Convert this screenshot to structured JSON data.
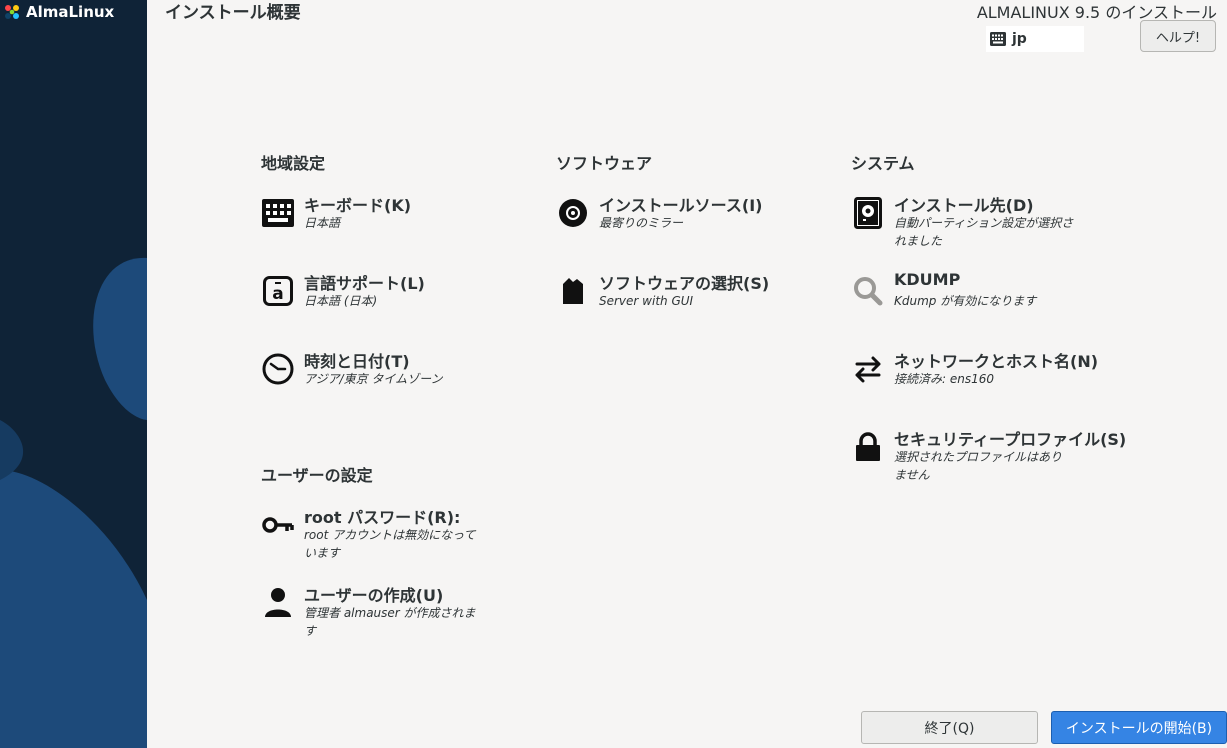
{
  "brand": {
    "name": "AlmaLinux"
  },
  "header": {
    "page_title": "インストール概要",
    "product_title": "ALMALINUX 9.5 のインストール",
    "keyboard_layout": "jp",
    "help_label": "ヘルプ!"
  },
  "sections": {
    "localization": "地域設定",
    "software": "ソフトウェア",
    "system": "システム",
    "user_settings": "ユーザーの設定"
  },
  "spokes": {
    "keyboard": {
      "title": "キーボード(K)",
      "status": "日本語"
    },
    "language": {
      "title": "言語サポート(L)",
      "status": "日本語 (日本)"
    },
    "datetime": {
      "title": "時刻と日付(T)",
      "status": "アジア/東京 タイムゾーン"
    },
    "install_source": {
      "title": "インストールソース(I)",
      "status": "最寄りのミラー"
    },
    "software_selection": {
      "title": "ソフトウェアの選択(S)",
      "status": "Server with GUI"
    },
    "install_destination": {
      "title": "インストール先(D)",
      "status": "自動パーティション設定が選択されました"
    },
    "kdump": {
      "title": "KDUMP",
      "status": "Kdump が有効になります"
    },
    "network": {
      "title": "ネットワークとホスト名(N)",
      "status": "接続済み: ens160"
    },
    "security": {
      "title": "セキュリティープロファイル(S)",
      "status": "選択されたプロファイルはありません"
    },
    "root_password": {
      "title": "root パスワード(R):",
      "status": "root アカウントは無効になっています"
    },
    "user_creation": {
      "title": "ユーザーの作成(U)",
      "status": "管理者 almauser が作成されます"
    }
  },
  "footer": {
    "quit_label": "終了(Q)",
    "begin_label": "インストールの開始(B)"
  },
  "colors": {
    "sidebar_bg": "#0f2337",
    "sidebar_shape": "#1d4a7a",
    "primary_button": "#3584e4",
    "page_bg": "#f6f5f4"
  }
}
